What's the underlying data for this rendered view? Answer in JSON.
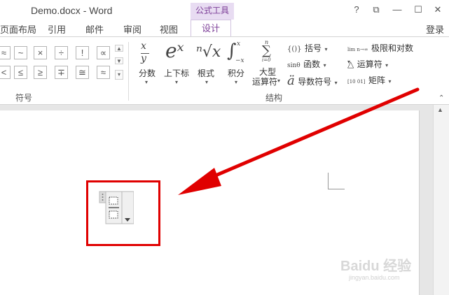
{
  "window": {
    "title": "Demo.docx - Word",
    "context_tab_group": "公式工具",
    "buttons": {
      "help": "?",
      "restore_ribbon": "⧉",
      "minimize": "—",
      "maximize": "☐",
      "close": "✕"
    },
    "login": "登录"
  },
  "tabs": [
    {
      "label": "页面布局"
    },
    {
      "label": "引用"
    },
    {
      "label": "邮件"
    },
    {
      "label": "审阅"
    },
    {
      "label": "视图"
    },
    {
      "label": "设计",
      "active": true
    }
  ],
  "symbols_group": {
    "label": "符号",
    "row1": [
      "≈",
      "~",
      "×",
      "÷",
      "!",
      "∝"
    ],
    "row2": [
      "<",
      "≤",
      "≥",
      "∓",
      "≅",
      "≈"
    ]
  },
  "structures_group": {
    "label": "结构",
    "big_buttons": [
      {
        "glyph_top": "x",
        "glyph_bottom": "y",
        "label": "分数"
      },
      {
        "glyph": "eˣ",
        "label": "上下标"
      },
      {
        "glyph": "ⁿ√x",
        "label": "根式"
      },
      {
        "glyph": "∫",
        "glyph_sup": "x",
        "glyph_sub": "−x",
        "label": "积分"
      },
      {
        "glyph": "∑",
        "glyph_sup": "n",
        "glyph_sub": "i=0",
        "label_line1": "大型",
        "label_line2": "运算符"
      }
    ],
    "small_buttons": [
      {
        "icon": "{()}",
        "label": "括号"
      },
      {
        "icon": "sinθ",
        "label": "函数"
      },
      {
        "icon": "ä",
        "label": "导数符号"
      },
      {
        "icon": "lim n→∞",
        "label": "极限和对数"
      },
      {
        "icon": "△",
        "label": "运算符"
      },
      {
        "icon": "[10 01]",
        "label": "矩阵"
      }
    ]
  },
  "watermark": {
    "text": "Baidu 经验",
    "url": "jingyan.baidu.com"
  },
  "colors": {
    "accent": "#7d3f98",
    "highlight": "#e00000",
    "arrow": "#e00000"
  }
}
